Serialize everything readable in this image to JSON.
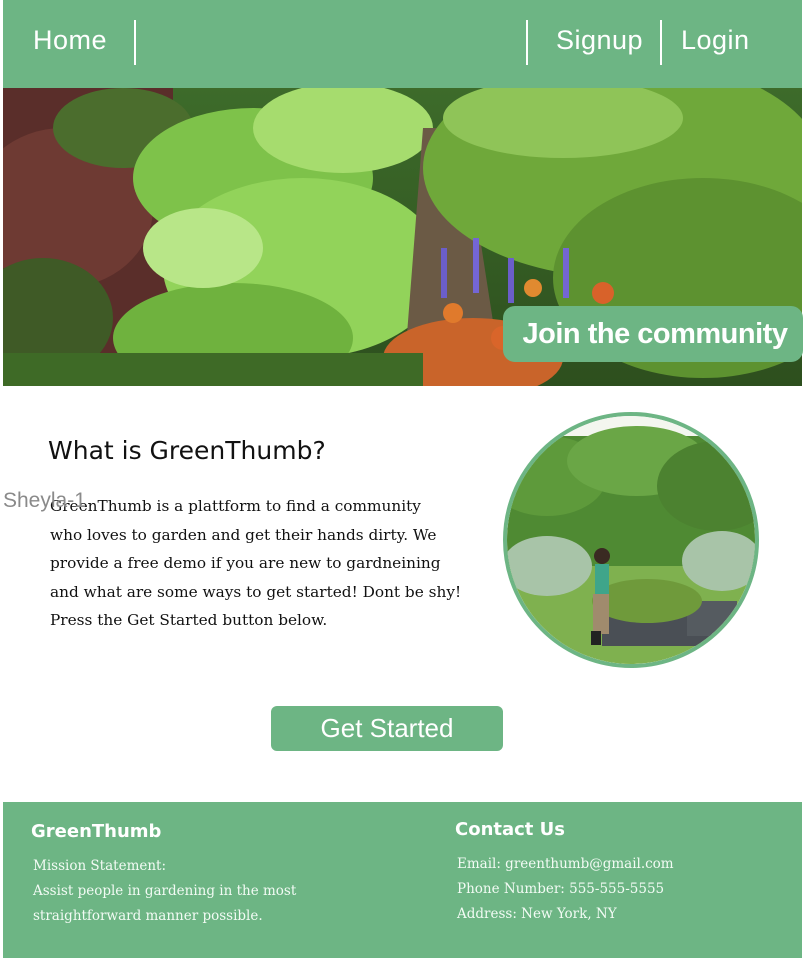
{
  "nav": {
    "home": "Home",
    "signup": "Signup",
    "login": "Login"
  },
  "hero": {
    "cta": "Join the community"
  },
  "about": {
    "title": "What is GreenThumb?",
    "overlay_label": "Sheyla-1",
    "lines": [
      "GreenThumb is a plattform to find a community",
      "who loves to garden and get their hands dirty. We",
      "provide a free demo if you are new to gardneining",
      "and what are some ways to get started! Dont be shy!",
      "Press the Get Started button below."
    ]
  },
  "cta": {
    "label": "Get Started"
  },
  "footer": {
    "brand": "GreenThumb",
    "mission_label": "Mission Statement:",
    "mission_lines": [
      "Assist people in gardening in the most",
      "straightforward manner possible."
    ],
    "contact_title": "Contact Us",
    "email": "Email: greenthumb@gmail.com",
    "phone": "Phone Number: 555-555-5555",
    "address": "Address: New York, NY"
  },
  "colors": {
    "brand_green": "#6db584",
    "text_dark": "#111111"
  }
}
